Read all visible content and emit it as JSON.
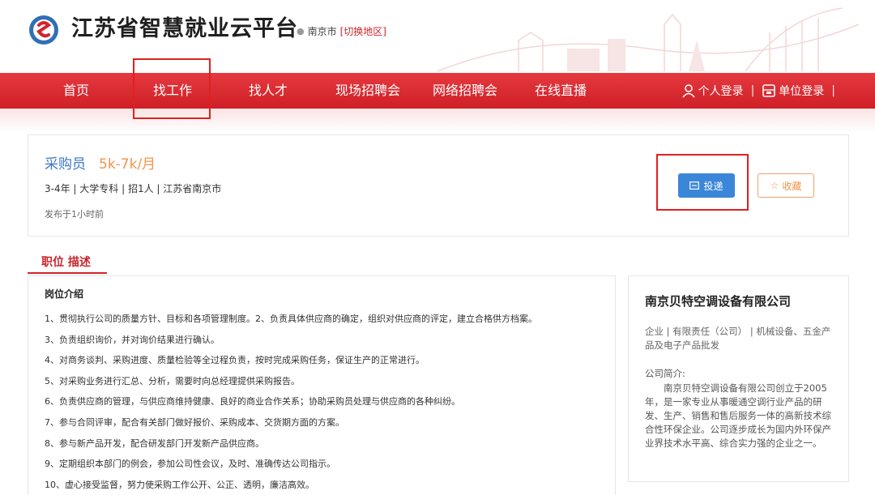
{
  "header": {
    "site_title": "江苏省智慧就业云平台",
    "location": {
      "city": "南京市",
      "switch_label": "[切换地区]"
    }
  },
  "nav": {
    "items": [
      {
        "label": "首页"
      },
      {
        "label": "找工作",
        "highlighted": true
      },
      {
        "label": "找人才"
      },
      {
        "label": "现场招聘会"
      },
      {
        "label": "网络招聘会"
      },
      {
        "label": "在线直播"
      }
    ],
    "personal_login": "个人登录",
    "company_login": "单位登录",
    "separator": "|"
  },
  "job": {
    "title": "采购员",
    "salary": "5k-7k/月",
    "meta": "3-4年 | 大学专科 | 招1人 | 江苏省南京市",
    "posted": "发布于1小时前",
    "apply_label": "投递",
    "favorite_label": "收藏"
  },
  "section": {
    "title": "职位 描述"
  },
  "description": {
    "heading": "岗位介绍",
    "lines": [
      "1、贯彻执行公司的质量方针、目标和各项管理制度。2、负责具体供应商的确定，组织对供应商的评定，建立合格供方档案。",
      "3、负责组织询价，并对询价结果进行确认。",
      "4、对商务谈判、采购进度、质量检验等全过程负责，按时完成采购任务，保证生产的正常进行。",
      "5、对采购业务进行汇总、分析，需要时向总经理提供采购报告。",
      "6、负责供应商的管理，与供应商维持健康、良好的商业合作关系；协助采购员处理与供应商的各种纠纷。",
      "7、参与合同评审，配合有关部门做好报价、采购成本、交货期方面的方案。",
      "8、参与新产品开发，配合研发部门开发新产品供应商。",
      "9、定期组织本部门的例会，参加公司性会议，及时、准确传达公司指示。",
      "10、虚心接受监督，努力使采购工作公开、公正、透明，廉洁高效。"
    ]
  },
  "company": {
    "name": "南京贝特空调设备有限公司",
    "tags": "企业 | 有限责任（公司） | 机械设备、五金产品及电子产品批发",
    "intro_label": "公司简介:",
    "intro": "南京贝特空调设备有限公司创立于2005年，是一家专业从事暖通空调行业产品的研发、生产、销售和售后服务一体的高新技术综合性环保企业。公司逐步成长为国内外环保产业界技术水平高、综合实力强的企业之一。"
  },
  "colors": {
    "brand_red": "#d3232a",
    "link_blue": "#3a77c6",
    "salary_orange": "#f0944b",
    "apply_blue": "#3a86d8"
  },
  "icons": {
    "logo": "platform-logo-icon",
    "location": "location-pin-icon",
    "person": "person-icon",
    "company": "building-icon",
    "apply": "send-icon",
    "favorite": "star-icon"
  }
}
